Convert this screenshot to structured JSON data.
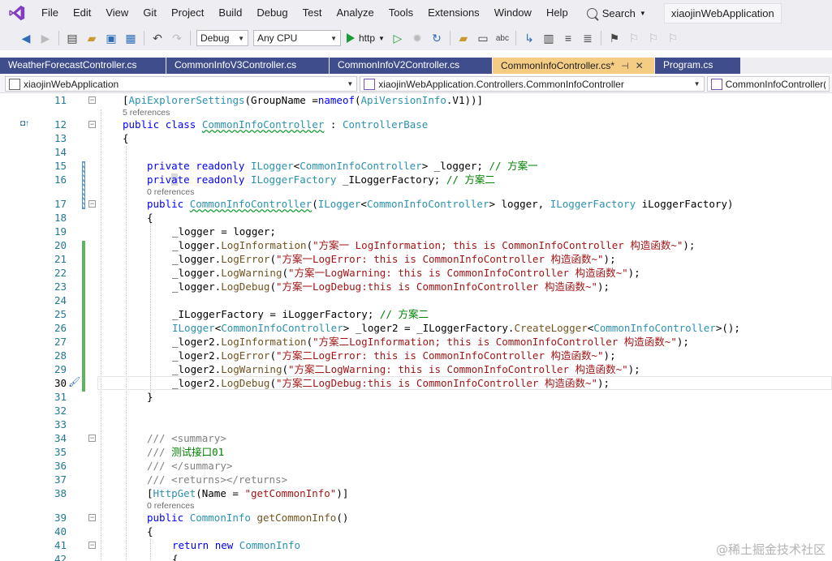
{
  "menu": {
    "items": [
      "File",
      "Edit",
      "View",
      "Git",
      "Project",
      "Build",
      "Debug",
      "Test",
      "Analyze",
      "Tools",
      "Extensions",
      "Window",
      "Help"
    ],
    "search_label": "Search",
    "solution_name": "xiaojinWebApplication"
  },
  "toolbar": {
    "config_value": "Debug",
    "platform_value": "Any CPU",
    "run_label": "http"
  },
  "tabs": [
    {
      "label": "WeatherForecastController.cs",
      "active": false
    },
    {
      "label": "CommonInfoV3Controller.cs",
      "active": false
    },
    {
      "label": "CommonInfoV2Controller.cs",
      "active": false
    },
    {
      "label": "CommonInfoController.cs*",
      "active": true
    },
    {
      "label": "Program.cs",
      "active": false
    }
  ],
  "navbar": {
    "project": "xiaojinWebApplication",
    "type": "xiaojinWebApplication.Controllers.CommonInfoController",
    "member": "CommonInfoController(IL"
  },
  "code": {
    "line_numbers": [
      "11",
      "12",
      "13",
      "14",
      "15",
      "16",
      "17",
      "18",
      "19",
      "20",
      "21",
      "22",
      "23",
      "24",
      "25",
      "26",
      "27",
      "28",
      "29",
      "30",
      "31",
      "32",
      "33",
      "34",
      "35",
      "36",
      "37",
      "38",
      "39",
      "40",
      "41",
      "42"
    ],
    "references": [
      "5 references",
      "0 references",
      "0 references"
    ]
  },
  "watermark": "@稀土掘金技术社区",
  "colors": {
    "menubar_bg": "#eeeef2",
    "tab_bg": "#3f4d8c",
    "active_tab_bg": "#f5cc84",
    "keyword": "#0000ff",
    "type": "#2b91af",
    "string": "#a31515",
    "comment": "#008000",
    "line_number": "#237893"
  }
}
